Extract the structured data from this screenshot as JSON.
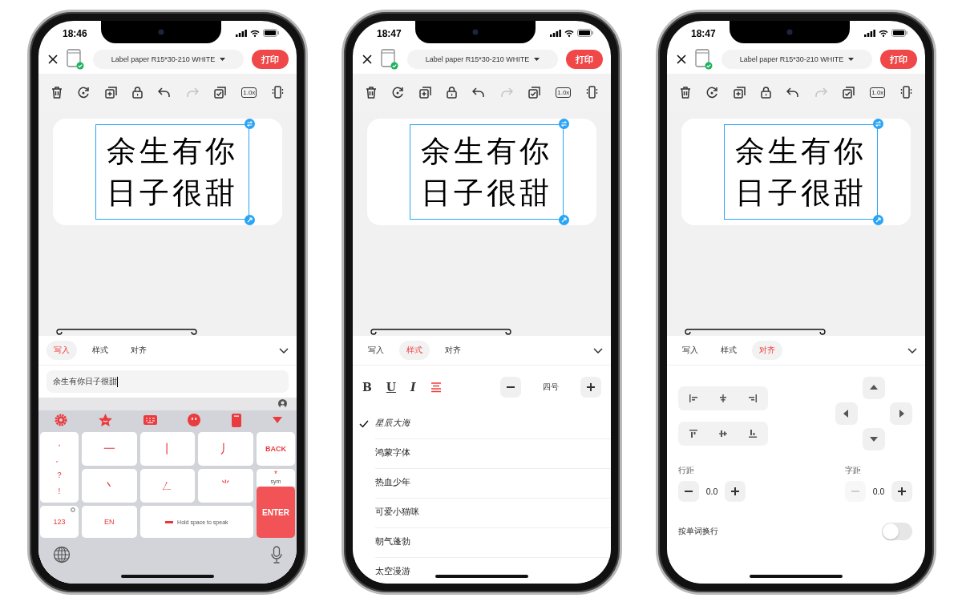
{
  "phones": [
    {
      "kind": "write",
      "time": "18:46",
      "paper": "Label paper R15*30-210 WHITE",
      "print": "打印",
      "zoom": "1.0x",
      "label_lines": [
        "余生有你",
        "日子很甜"
      ],
      "tabs": [
        {
          "label": "写入",
          "selected": true
        },
        {
          "label": "样式",
          "selected": false
        },
        {
          "label": "对齐",
          "selected": false
        }
      ],
      "input": {
        "value": "余生有你日子很甜"
      },
      "keyboard": {
        "punctuation": [
          "，",
          "。",
          "？",
          "！"
        ],
        "strokes": [
          "一",
          "丨",
          "丿",
          "丶",
          "ㄥ",
          "⺌"
        ],
        "back": "BACK",
        "sym_symbol": "*",
        "sym": "sym",
        "enter": "ENTER",
        "num": "123",
        "lang": "EN",
        "space": "Hold space to speak"
      }
    },
    {
      "kind": "style",
      "time": "18:47",
      "paper": "Label paper R15*30-210 WHITE",
      "print": "打印",
      "zoom": "1.0x",
      "label_lines": [
        "余生有你",
        "日子很甜"
      ],
      "tabs": [
        {
          "label": "写入",
          "selected": false
        },
        {
          "label": "样式",
          "selected": true
        },
        {
          "label": "对齐",
          "selected": false
        }
      ],
      "format": {
        "bold": "B",
        "underline": "U",
        "italic": "I"
      },
      "size": "四号",
      "fonts": [
        {
          "name": "星辰大海",
          "selected": true
        },
        {
          "name": "鸿蒙字体",
          "selected": false
        },
        {
          "name": "热血少年",
          "selected": false
        },
        {
          "name": "可爱小猫咪",
          "selected": false
        },
        {
          "name": "朝气蓬勃",
          "selected": false
        },
        {
          "name": "太空漫游",
          "selected": false
        }
      ]
    },
    {
      "kind": "align",
      "time": "18:47",
      "paper": "Label paper R15*30-210 WHITE",
      "print": "打印",
      "zoom": "1.0x",
      "label_lines": [
        "余生有你",
        "日子很甜"
      ],
      "tabs": [
        {
          "label": "写入",
          "selected": false
        },
        {
          "label": "样式",
          "selected": false
        },
        {
          "label": "对齐",
          "selected": true
        }
      ],
      "line_spacing": {
        "label": "行距",
        "value": "0.0",
        "minus_disabled": false
      },
      "letter_spacing": {
        "label": "字距",
        "value": "0.0",
        "minus_disabled": true
      },
      "wrap": {
        "label": "按单词换行",
        "on": false
      }
    }
  ]
}
